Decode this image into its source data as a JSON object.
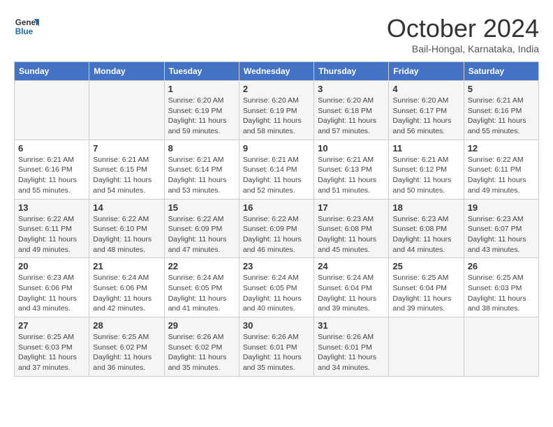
{
  "logo": {
    "line1": "General",
    "line2": "Blue"
  },
  "title": "October 2024",
  "subtitle": "Bail-Hongal, Karnataka, India",
  "days_of_week": [
    "Sunday",
    "Monday",
    "Tuesday",
    "Wednesday",
    "Thursday",
    "Friday",
    "Saturday"
  ],
  "weeks": [
    [
      {
        "day": "",
        "info": ""
      },
      {
        "day": "",
        "info": ""
      },
      {
        "day": "1",
        "info": "Sunrise: 6:20 AM\nSunset: 6:19 PM\nDaylight: 11 hours and 59 minutes."
      },
      {
        "day": "2",
        "info": "Sunrise: 6:20 AM\nSunset: 6:19 PM\nDaylight: 11 hours and 58 minutes."
      },
      {
        "day": "3",
        "info": "Sunrise: 6:20 AM\nSunset: 6:18 PM\nDaylight: 11 hours and 57 minutes."
      },
      {
        "day": "4",
        "info": "Sunrise: 6:20 AM\nSunset: 6:17 PM\nDaylight: 11 hours and 56 minutes."
      },
      {
        "day": "5",
        "info": "Sunrise: 6:21 AM\nSunset: 6:16 PM\nDaylight: 11 hours and 55 minutes."
      }
    ],
    [
      {
        "day": "6",
        "info": "Sunrise: 6:21 AM\nSunset: 6:16 PM\nDaylight: 11 hours and 55 minutes."
      },
      {
        "day": "7",
        "info": "Sunrise: 6:21 AM\nSunset: 6:15 PM\nDaylight: 11 hours and 54 minutes."
      },
      {
        "day": "8",
        "info": "Sunrise: 6:21 AM\nSunset: 6:14 PM\nDaylight: 11 hours and 53 minutes."
      },
      {
        "day": "9",
        "info": "Sunrise: 6:21 AM\nSunset: 6:14 PM\nDaylight: 11 hours and 52 minutes."
      },
      {
        "day": "10",
        "info": "Sunrise: 6:21 AM\nSunset: 6:13 PM\nDaylight: 11 hours and 51 minutes."
      },
      {
        "day": "11",
        "info": "Sunrise: 6:21 AM\nSunset: 6:12 PM\nDaylight: 11 hours and 50 minutes."
      },
      {
        "day": "12",
        "info": "Sunrise: 6:22 AM\nSunset: 6:11 PM\nDaylight: 11 hours and 49 minutes."
      }
    ],
    [
      {
        "day": "13",
        "info": "Sunrise: 6:22 AM\nSunset: 6:11 PM\nDaylight: 11 hours and 49 minutes."
      },
      {
        "day": "14",
        "info": "Sunrise: 6:22 AM\nSunset: 6:10 PM\nDaylight: 11 hours and 48 minutes."
      },
      {
        "day": "15",
        "info": "Sunrise: 6:22 AM\nSunset: 6:09 PM\nDaylight: 11 hours and 47 minutes."
      },
      {
        "day": "16",
        "info": "Sunrise: 6:22 AM\nSunset: 6:09 PM\nDaylight: 11 hours and 46 minutes."
      },
      {
        "day": "17",
        "info": "Sunrise: 6:23 AM\nSunset: 6:08 PM\nDaylight: 11 hours and 45 minutes."
      },
      {
        "day": "18",
        "info": "Sunrise: 6:23 AM\nSunset: 6:08 PM\nDaylight: 11 hours and 44 minutes."
      },
      {
        "day": "19",
        "info": "Sunrise: 6:23 AM\nSunset: 6:07 PM\nDaylight: 11 hours and 43 minutes."
      }
    ],
    [
      {
        "day": "20",
        "info": "Sunrise: 6:23 AM\nSunset: 6:06 PM\nDaylight: 11 hours and 43 minutes."
      },
      {
        "day": "21",
        "info": "Sunrise: 6:24 AM\nSunset: 6:06 PM\nDaylight: 11 hours and 42 minutes."
      },
      {
        "day": "22",
        "info": "Sunrise: 6:24 AM\nSunset: 6:05 PM\nDaylight: 11 hours and 41 minutes."
      },
      {
        "day": "23",
        "info": "Sunrise: 6:24 AM\nSunset: 6:05 PM\nDaylight: 11 hours and 40 minutes."
      },
      {
        "day": "24",
        "info": "Sunrise: 6:24 AM\nSunset: 6:04 PM\nDaylight: 11 hours and 39 minutes."
      },
      {
        "day": "25",
        "info": "Sunrise: 6:25 AM\nSunset: 6:04 PM\nDaylight: 11 hours and 39 minutes."
      },
      {
        "day": "26",
        "info": "Sunrise: 6:25 AM\nSunset: 6:03 PM\nDaylight: 11 hours and 38 minutes."
      }
    ],
    [
      {
        "day": "27",
        "info": "Sunrise: 6:25 AM\nSunset: 6:03 PM\nDaylight: 11 hours and 37 minutes."
      },
      {
        "day": "28",
        "info": "Sunrise: 6:25 AM\nSunset: 6:02 PM\nDaylight: 11 hours and 36 minutes."
      },
      {
        "day": "29",
        "info": "Sunrise: 6:26 AM\nSunset: 6:02 PM\nDaylight: 11 hours and 35 minutes."
      },
      {
        "day": "30",
        "info": "Sunrise: 6:26 AM\nSunset: 6:01 PM\nDaylight: 11 hours and 35 minutes."
      },
      {
        "day": "31",
        "info": "Sunrise: 6:26 AM\nSunset: 6:01 PM\nDaylight: 11 hours and 34 minutes."
      },
      {
        "day": "",
        "info": ""
      },
      {
        "day": "",
        "info": ""
      }
    ]
  ]
}
